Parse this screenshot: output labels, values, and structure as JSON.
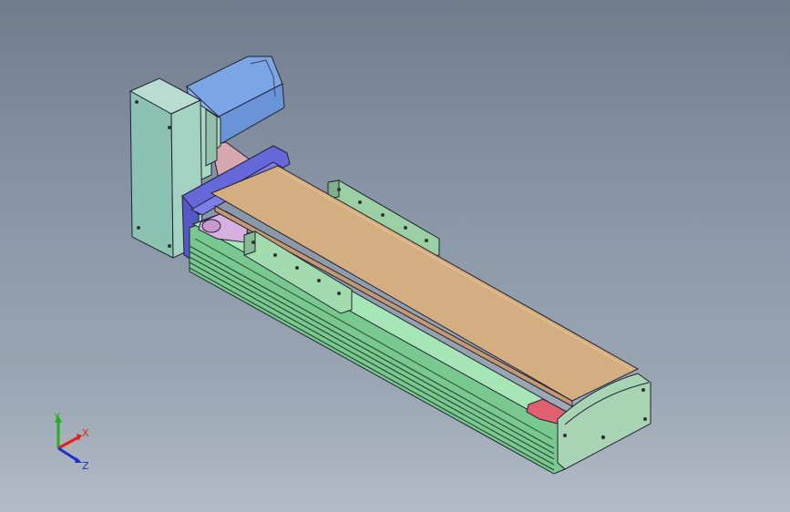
{
  "viewport": {
    "background_top": "#6f7c8c",
    "background_bottom": "#b3bcc6"
  },
  "model": {
    "parts": [
      "motor-housing",
      "motor-flange-block",
      "coupling-cover",
      "end-plate-front",
      "carriage-top-cover",
      "base-extrusion",
      "side-rail-left",
      "side-rail-right",
      "end-cap-rear",
      "stopper-block"
    ],
    "colors": {
      "motor_blue": "#6e9be0",
      "housing_mint": "#9cc8b0",
      "flange_indigo": "#6468d8",
      "coupling_pink": "#d8a8b0",
      "cover_tan": "#d4b082",
      "extrusion_green": "#8ad8a0",
      "rail_mint": "#9ad0a4",
      "endcap_mint": "#a8d4b4",
      "stopper_red": "#e06070"
    }
  },
  "triad": {
    "x_label": "X",
    "y_label": "Y",
    "z_label": "Z",
    "x_color": "#e02020",
    "y_color": "#20b020",
    "z_color": "#2030d0"
  }
}
